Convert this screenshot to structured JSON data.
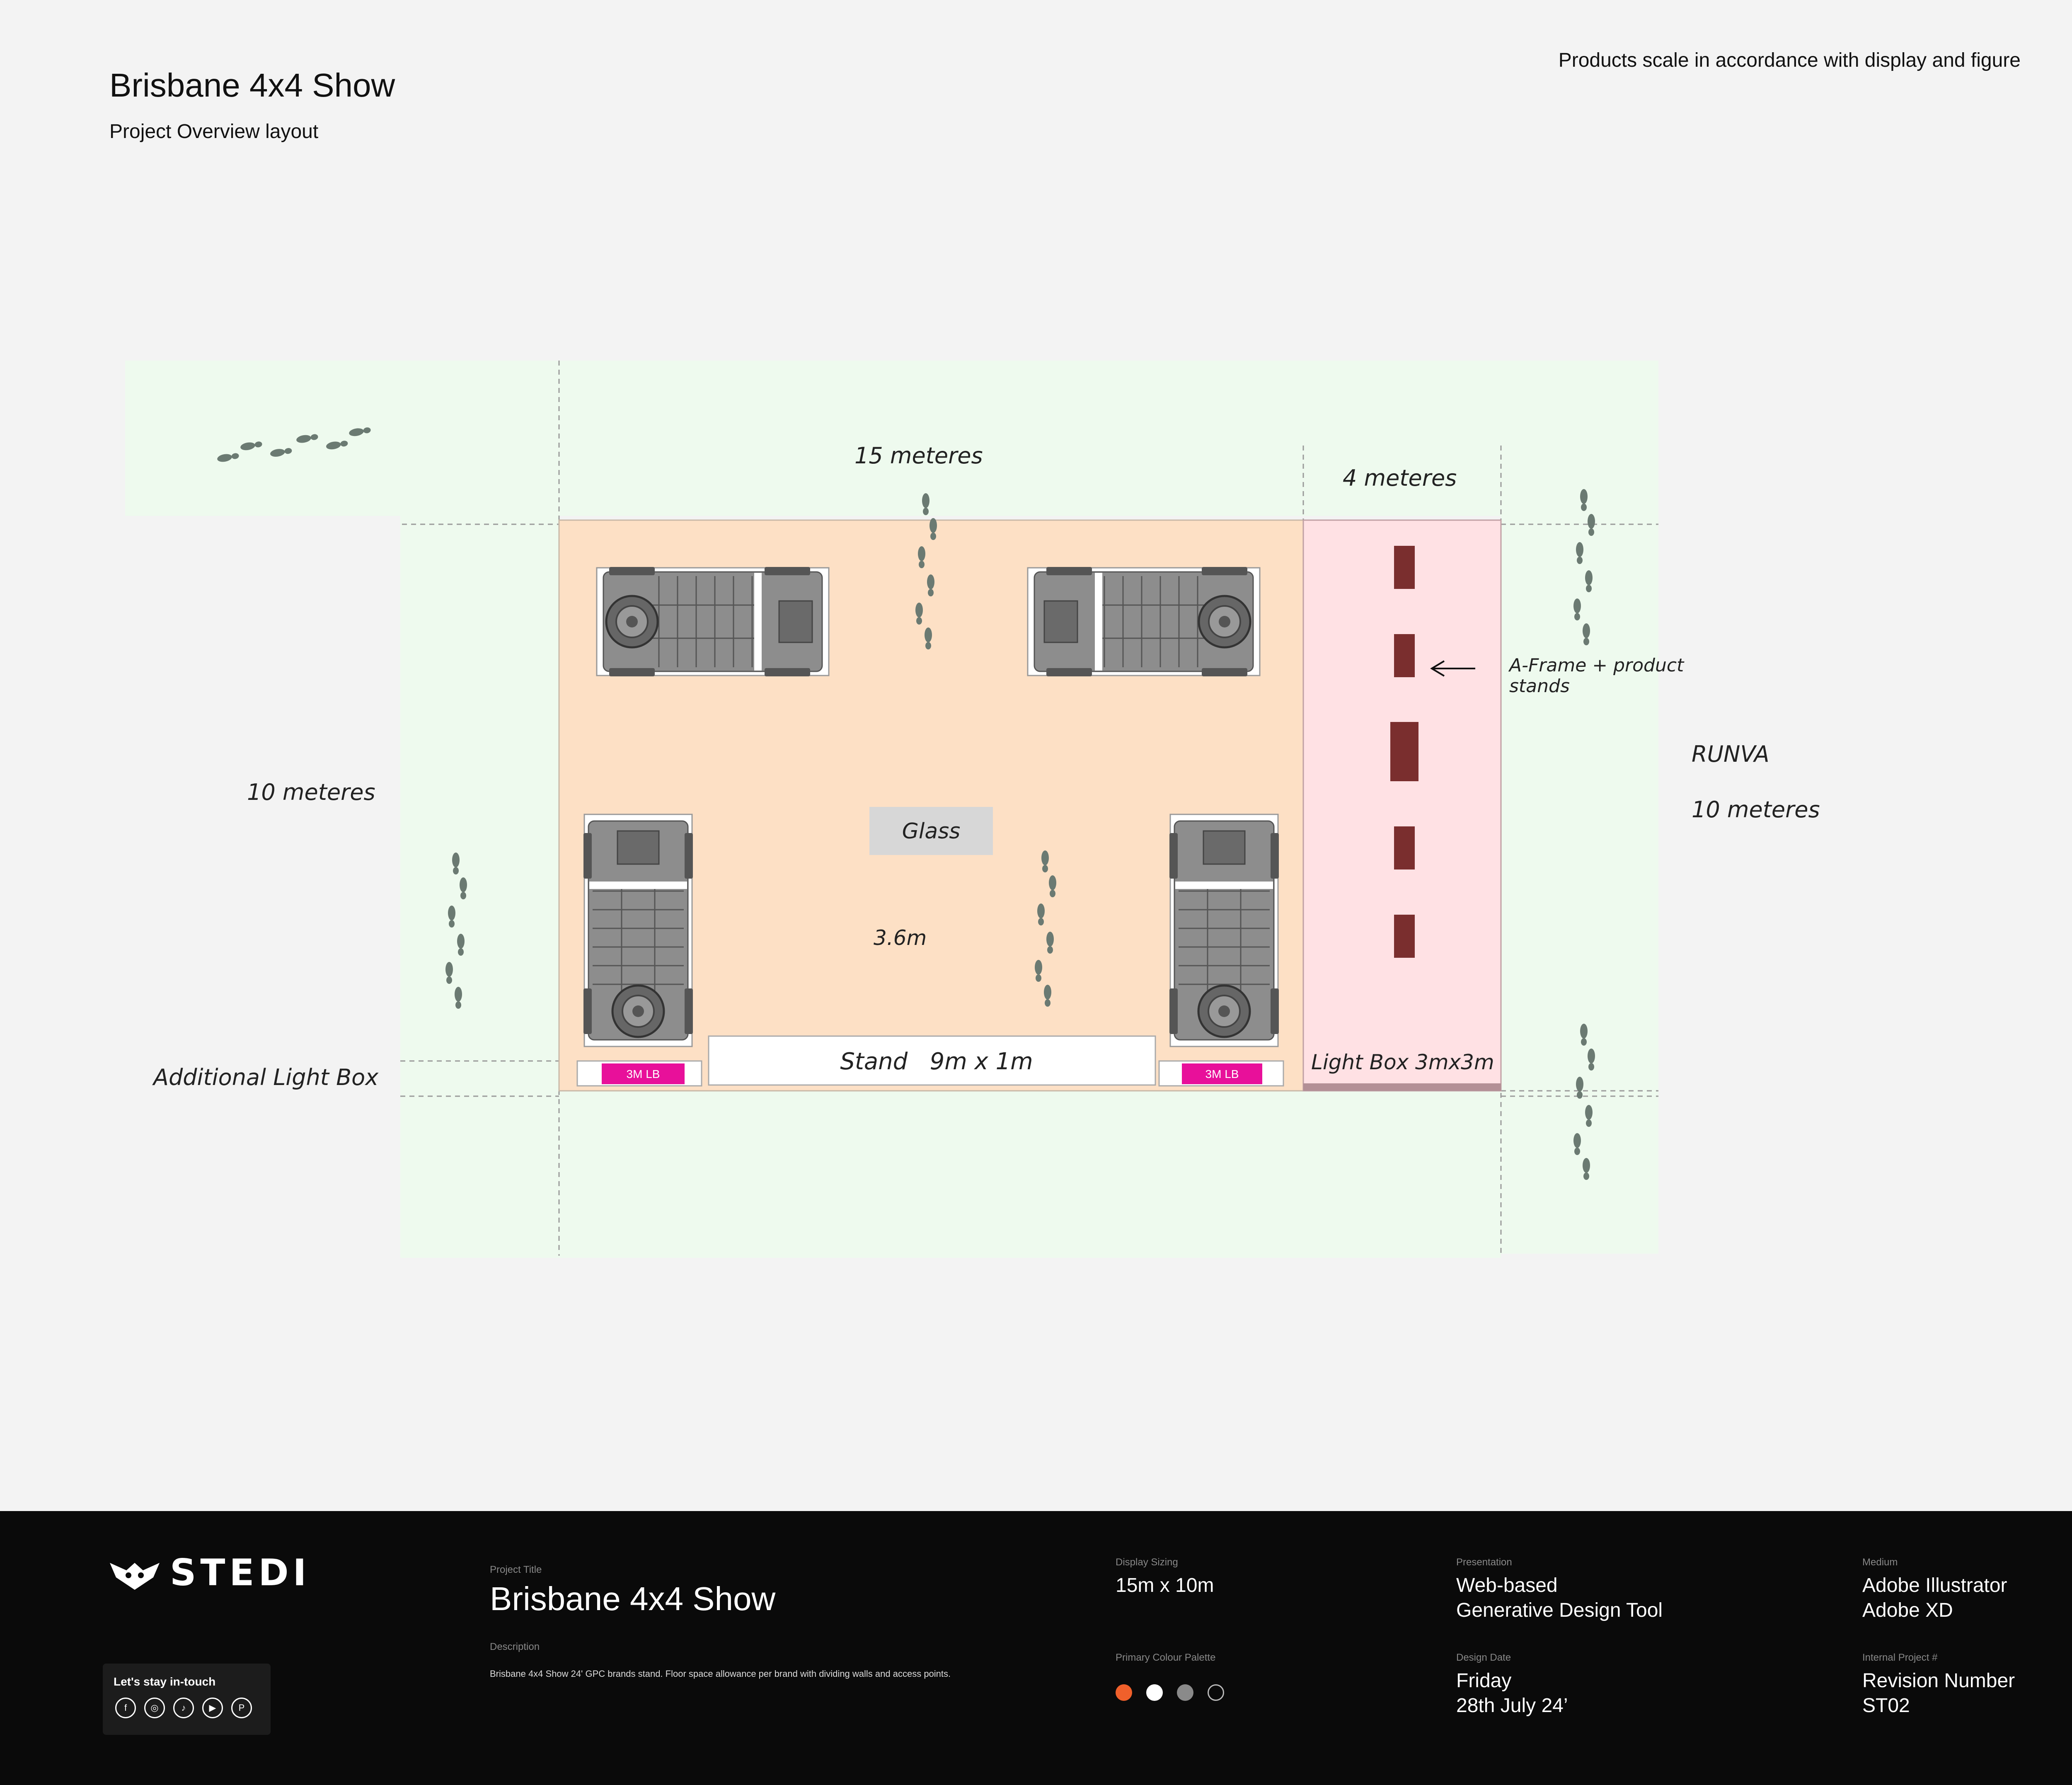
{
  "header": {
    "title": "Brisbane 4x4 Show",
    "subtitle": "Project Overview layout",
    "note": "Products scale in accordance with display and figure"
  },
  "plan": {
    "label_15m": "15 meteres",
    "label_4m": "4 meteres",
    "label_10m_left": "10 meteres",
    "label_runva": "RUNVA",
    "label_10m_right": "10 meteres",
    "label_aframe_1": "A-Frame + product",
    "label_aframe_2": "stands",
    "label_glass": "Glass",
    "label_36": "3.6m",
    "label_stand": "Stand   9m x 1m",
    "label_lightbox": "Light Box 3mx3m",
    "label_additional": "Additional Light Box",
    "lb_badge": "3M LB",
    "colors": {
      "walkway": "#eefaee",
      "stand": "#fde0c5",
      "runva": "#ffe1e4",
      "product": "#7a2e2e",
      "badge": "#e8109a",
      "vehicle": "#8a8a8a",
      "footprint": "#6b7a72"
    }
  },
  "footer": {
    "logo_text": "STEDI",
    "social_title": "Let's stay in-touch",
    "social_icons": [
      "facebook-icon",
      "instagram-icon",
      "tiktok-icon",
      "youtube-icon",
      "pinterest-icon"
    ],
    "social_glyphs": [
      "f",
      "◎",
      "♪",
      "▶",
      "P"
    ],
    "project_title_label": "Project Title",
    "project_title": "Brisbane 4x4 Show",
    "description_label": "Description",
    "description": "Brisbane 4x4 Show 24' GPC brands stand. Floor space allowance per brand with dividing walls and access points.",
    "display_sizing_label": "Display Sizing",
    "display_sizing": "15m x 10m",
    "palette_label": "Primary Colour Palette",
    "palette": [
      "#f0602b",
      "#ffffff",
      "#8a8a8a",
      "#0a0a0a"
    ],
    "presentation_label": "Presentation",
    "presentation_1": "Web-based",
    "presentation_2": "Generative Design Tool",
    "design_date_label": "Design Date",
    "design_date_1": "Friday",
    "design_date_2": "28th July 24’",
    "medium_label": "Medium",
    "medium_1": "Adobe Illustrator",
    "medium_2": "Adobe XD",
    "internal_label": "Internal Project #",
    "internal_1": "Revision Number",
    "internal_2": "ST02"
  }
}
